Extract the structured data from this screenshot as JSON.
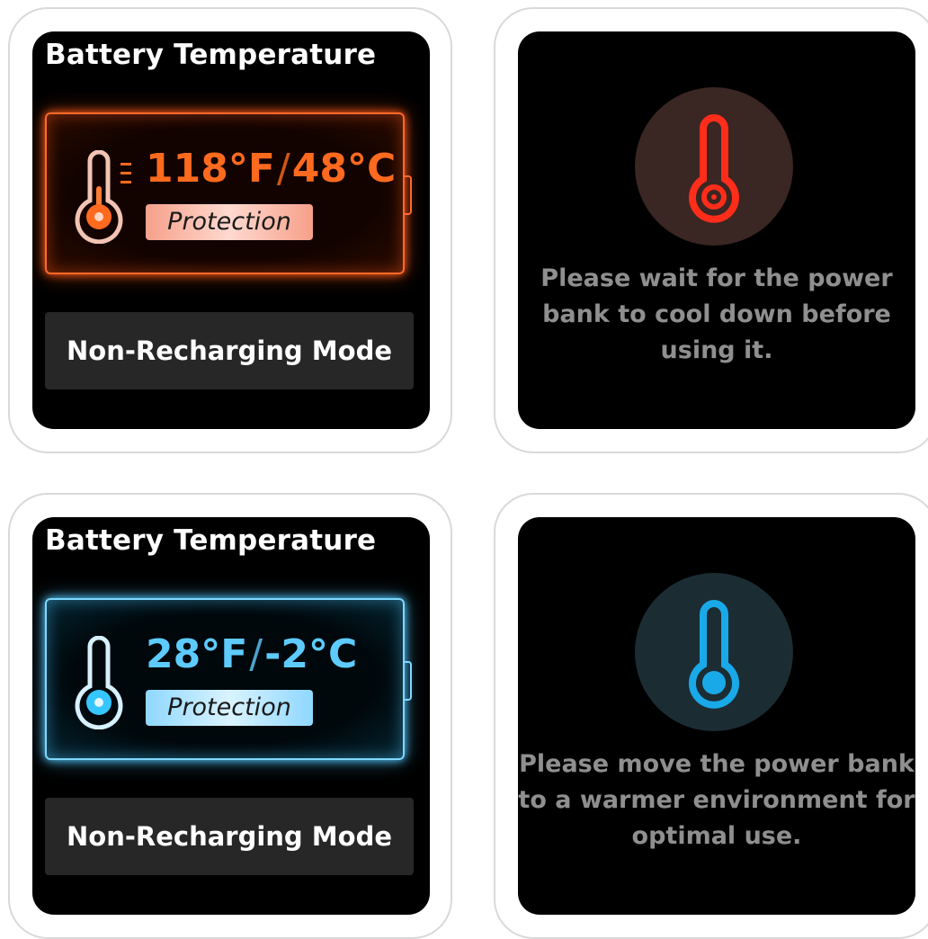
{
  "panels": {
    "hot_status": {
      "title": "Battery Temperature",
      "temp_f": "118°F",
      "temp_c": "48°C",
      "separator": "/",
      "badge": "Protection",
      "mode_button": "Non-Recharging Mode",
      "accent_color": "#ff6a1e"
    },
    "hot_message": {
      "icon": "thermometer-hot-icon",
      "text": "Please wait for the power bank to cool down before using it.",
      "accent_color": "#ff2d1a"
    },
    "cold_status": {
      "title": "Battery Temperature",
      "temp_f": "28°F",
      "temp_c": "-2°C",
      "separator": "/",
      "badge": "Protection",
      "mode_button": "Non-Recharging Mode",
      "accent_color": "#5ecbff"
    },
    "cold_message": {
      "icon": "thermometer-cold-icon",
      "text": "Please move the power bank to a warmer environment for optimal use.",
      "accent_color": "#19a9e8"
    }
  }
}
